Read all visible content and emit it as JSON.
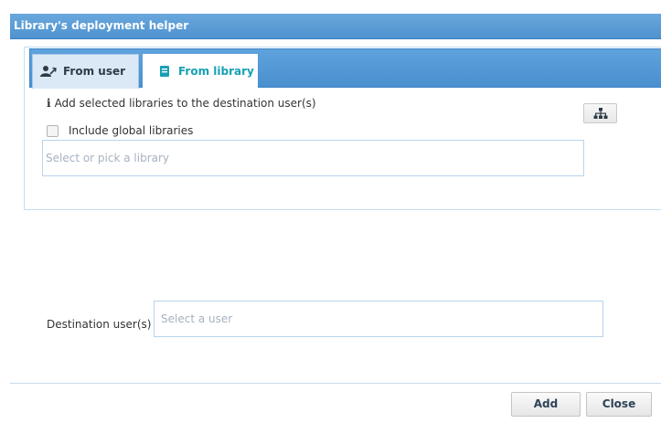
{
  "dialog": {
    "title": "Library's deployment helper"
  },
  "tabs": [
    {
      "label": "From user",
      "icon": "user-arrow-icon",
      "active": false
    },
    {
      "label": "From library",
      "icon": "book-icon",
      "active": true
    }
  ],
  "library_tab": {
    "info_icon": "info-icon",
    "info_text": "Add selected libraries to the destination user(s)",
    "include_global_label": "Include global libraries",
    "include_global_checked": false,
    "library_placeholder": "Select or pick a library",
    "picker_icon": "hierarchy-icon"
  },
  "destination": {
    "label": "Destination user(s)",
    "placeholder": "Select a user"
  },
  "footer": {
    "add_label": "Add",
    "close_label": "Close"
  },
  "colors": {
    "header": "#4f92cf",
    "active_tab_text": "#17a0b4",
    "border": "#b9d4ec"
  }
}
